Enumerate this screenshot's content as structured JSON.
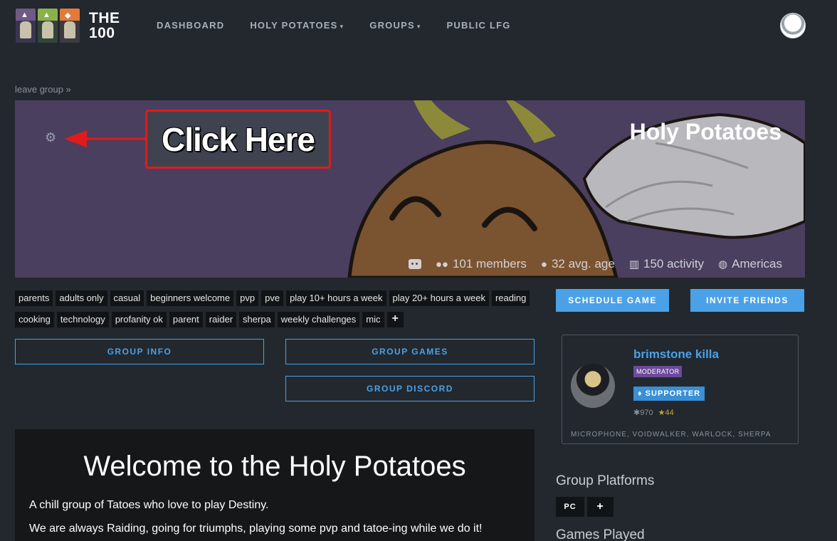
{
  "nav": {
    "logo_text_line1": "THE",
    "logo_text_line2": "100",
    "links": [
      "DASHBOARD",
      "HOLY POTATOES",
      "GROUPS",
      "PUBLIC LFG"
    ],
    "caret": "▾"
  },
  "breadcrumb": "leave group »",
  "banner": {
    "title": "Holy Potatoes",
    "annotation": "Click Here",
    "stats": {
      "members": "101 members",
      "avg_age": "32 avg. age",
      "activity": "150 activity",
      "region": "Americas"
    },
    "colors": {
      "background": "#4a3f5e",
      "potato": "#7a5330",
      "wing": "#b9b9bd",
      "annotation_border": "#e11b1b"
    }
  },
  "tags": [
    "parents",
    "adults only",
    "casual",
    "beginners welcome",
    "pvp",
    "pve",
    "play 10+ hours a week",
    "play 20+ hours a week",
    "reading",
    "cooking",
    "technology",
    "profanity ok",
    "parent",
    "raider",
    "sherpa",
    "weekly challenges",
    "mic",
    "+"
  ],
  "buttons": {
    "group_info": "GROUP INFO",
    "group_games": "GROUP GAMES",
    "group_discord": "GROUP DISCORD",
    "schedule_game": "SCHEDULE GAME",
    "invite_friends": "INVITE FRIENDS"
  },
  "welcome": {
    "title": "Welcome to the Holy Potatoes",
    "p1": "A chill group of Tatoes who love to play Destiny.",
    "p2": "We are always Raiding, going for triumphs, playing some pvp and tatoe-ing while we do it!"
  },
  "moderator": {
    "name": "brimstone killa",
    "role_badge": "MODERATOR",
    "supporter_badge": "SUPPORTER",
    "karma": "970",
    "stars": "44",
    "tags": "MICROPHONE, VOIDWALKER, WARLOCK, SHERPA"
  },
  "sections": {
    "platforms_title": "Group Platforms",
    "platforms": [
      "PC",
      "+"
    ],
    "games_title": "Games Played"
  },
  "accent_color": "#4aa1e8"
}
